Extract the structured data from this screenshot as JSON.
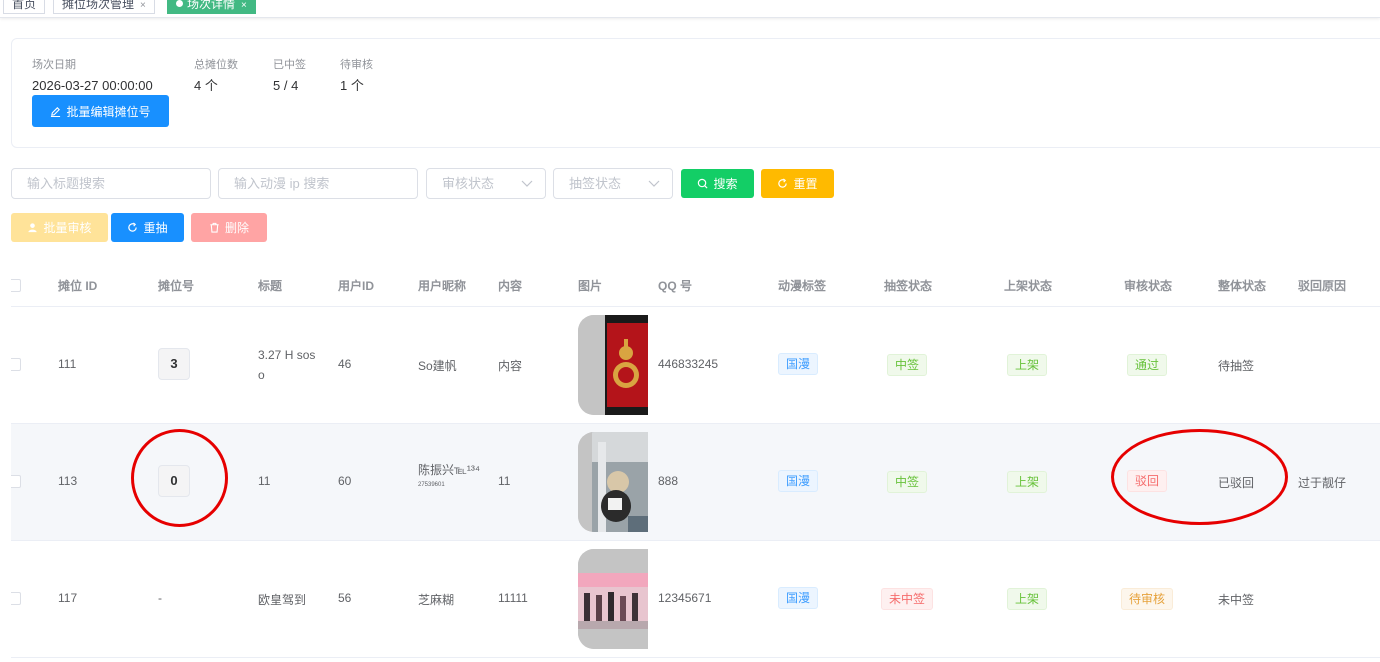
{
  "tabs": [
    {
      "label": "首页",
      "close": false
    },
    {
      "label": "摊位场次管理",
      "close": true
    },
    {
      "label": "场次详情",
      "close": true,
      "active": true
    }
  ],
  "stats": [
    {
      "label": "场次日期",
      "value": "2026-03-27 00:00:00"
    },
    {
      "label": "总摊位数",
      "value": "4 个"
    },
    {
      "label": "已中签",
      "value": "5 / 4"
    },
    {
      "label": "待审核",
      "value": "1 个"
    }
  ],
  "batch_edit_label": "批量编辑摊位号",
  "filters": {
    "title_placeholder": "输入标题搜索",
    "ip_placeholder": "输入动漫 ip 搜索",
    "review_status_placeholder": "审核状态",
    "draw_status_placeholder": "抽签状态",
    "search_label": "搜索",
    "reset_label": "重置"
  },
  "actions": {
    "batch_review_label": "批量审核",
    "redraw_label": "重抽",
    "delete_label": "删除"
  },
  "columns": [
    "摊位 ID",
    "摊位号",
    "标题",
    "用户ID",
    "用户昵称",
    "内容",
    "图片",
    "QQ 号",
    "动漫标签",
    "抽签状态",
    "上架状态",
    "审核状态",
    "整体状态",
    "驳回原因"
  ],
  "rows": [
    {
      "id": "111",
      "booth_no": "3",
      "title_l1": "3.27 H sos",
      "title_l2": "o",
      "user_id": "46",
      "nickname": "So建帆",
      "nickname_extra": "",
      "content": "内容",
      "qq": "446833245",
      "anime_tag": "国漫",
      "draw_status": "中签",
      "shelf_status": "上架",
      "review_status": "通过",
      "overall_status": "待抽签",
      "reject_reason": ""
    },
    {
      "id": "113",
      "booth_no": "0",
      "title_l1": "11",
      "title_l2": "",
      "user_id": "60",
      "nickname": "陈振兴℡¹³⁴",
      "nickname_extra": "27539601",
      "content": "11",
      "qq": "888",
      "anime_tag": "国漫",
      "draw_status": "中签",
      "shelf_status": "上架",
      "review_status": "驳回",
      "overall_status": "已驳回",
      "reject_reason": "过于靓仔"
    },
    {
      "id": "117",
      "booth_no": "-",
      "title_l1": "欧皇驾到",
      "title_l2": "",
      "user_id": "56",
      "nickname": "芝麻糊",
      "nickname_extra": "",
      "content": "11111",
      "qq": "12345671",
      "anime_tag": "国漫",
      "draw_status": "未中签",
      "shelf_status": "上架",
      "review_status": "待审核",
      "overall_status": "未中签",
      "reject_reason": ""
    }
  ],
  "colors": {
    "primary": "#1890ff",
    "success": "#13ce66",
    "warning": "#ffba00",
    "danger": "#ff4949",
    "annotation": "#e60000"
  }
}
